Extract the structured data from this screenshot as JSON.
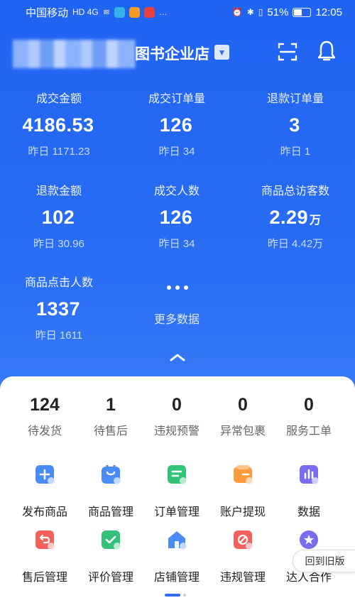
{
  "status_bar": {
    "carrier": "中国移动",
    "network": "HD 4G",
    "battery": "51%",
    "battery_level": 0.51,
    "time": "12:05"
  },
  "header": {
    "shop_name": "图书企业店",
    "icons": [
      "scan-icon",
      "bell-icon"
    ]
  },
  "stats": [
    {
      "label": "成交金额",
      "value": "4186.53",
      "unit": "",
      "yesterday": "昨日 1171.23"
    },
    {
      "label": "成交订单量",
      "value": "126",
      "unit": "",
      "yesterday": "昨日 34"
    },
    {
      "label": "退款订单量",
      "value": "3",
      "unit": "",
      "yesterday": "昨日 1"
    },
    {
      "label": "退款金额",
      "value": "102",
      "unit": "",
      "yesterday": "昨日 30.96"
    },
    {
      "label": "成交人数",
      "value": "126",
      "unit": "",
      "yesterday": "昨日 34"
    },
    {
      "label": "商品总访客数",
      "value": "2.29",
      "unit": "万",
      "yesterday": "昨日 4.42万"
    },
    {
      "label": "商品点击人数",
      "value": "1337",
      "unit": "",
      "yesterday": "昨日 1611"
    }
  ],
  "more_data": {
    "label": "更多数据"
  },
  "counts": [
    {
      "num": "124",
      "label": "待发货"
    },
    {
      "num": "1",
      "label": "待售后"
    },
    {
      "num": "0",
      "label": "违规预警"
    },
    {
      "num": "0",
      "label": "异常包裹"
    },
    {
      "num": "0",
      "label": "服务工单"
    }
  ],
  "tools": [
    {
      "label": "发布商品",
      "icon": "publish-product-icon",
      "color": "#4a8cf7"
    },
    {
      "label": "商品管理",
      "icon": "shopping-bag-icon",
      "color": "#4a8cf7"
    },
    {
      "label": "订单管理",
      "icon": "order-list-icon",
      "color": "#33c27a"
    },
    {
      "label": "账户提现",
      "icon": "wallet-icon",
      "color": "#ff9a3c"
    },
    {
      "label": "数据",
      "icon": "bar-chart-icon",
      "color": "#7a6cf0"
    },
    {
      "label": "售后管理",
      "icon": "return-icon",
      "color": "#f5605a"
    },
    {
      "label": "评价管理",
      "icon": "check-review-icon",
      "color": "#33c27a"
    },
    {
      "label": "店铺管理",
      "icon": "store-icon",
      "color": "#4a8cf7"
    },
    {
      "label": "违规管理",
      "icon": "violation-icon",
      "color": "#f5605a"
    },
    {
      "label": "达人合作",
      "icon": "star-icon",
      "color": "#7a6cf0"
    }
  ],
  "old_version": {
    "label": "回到旧版"
  }
}
